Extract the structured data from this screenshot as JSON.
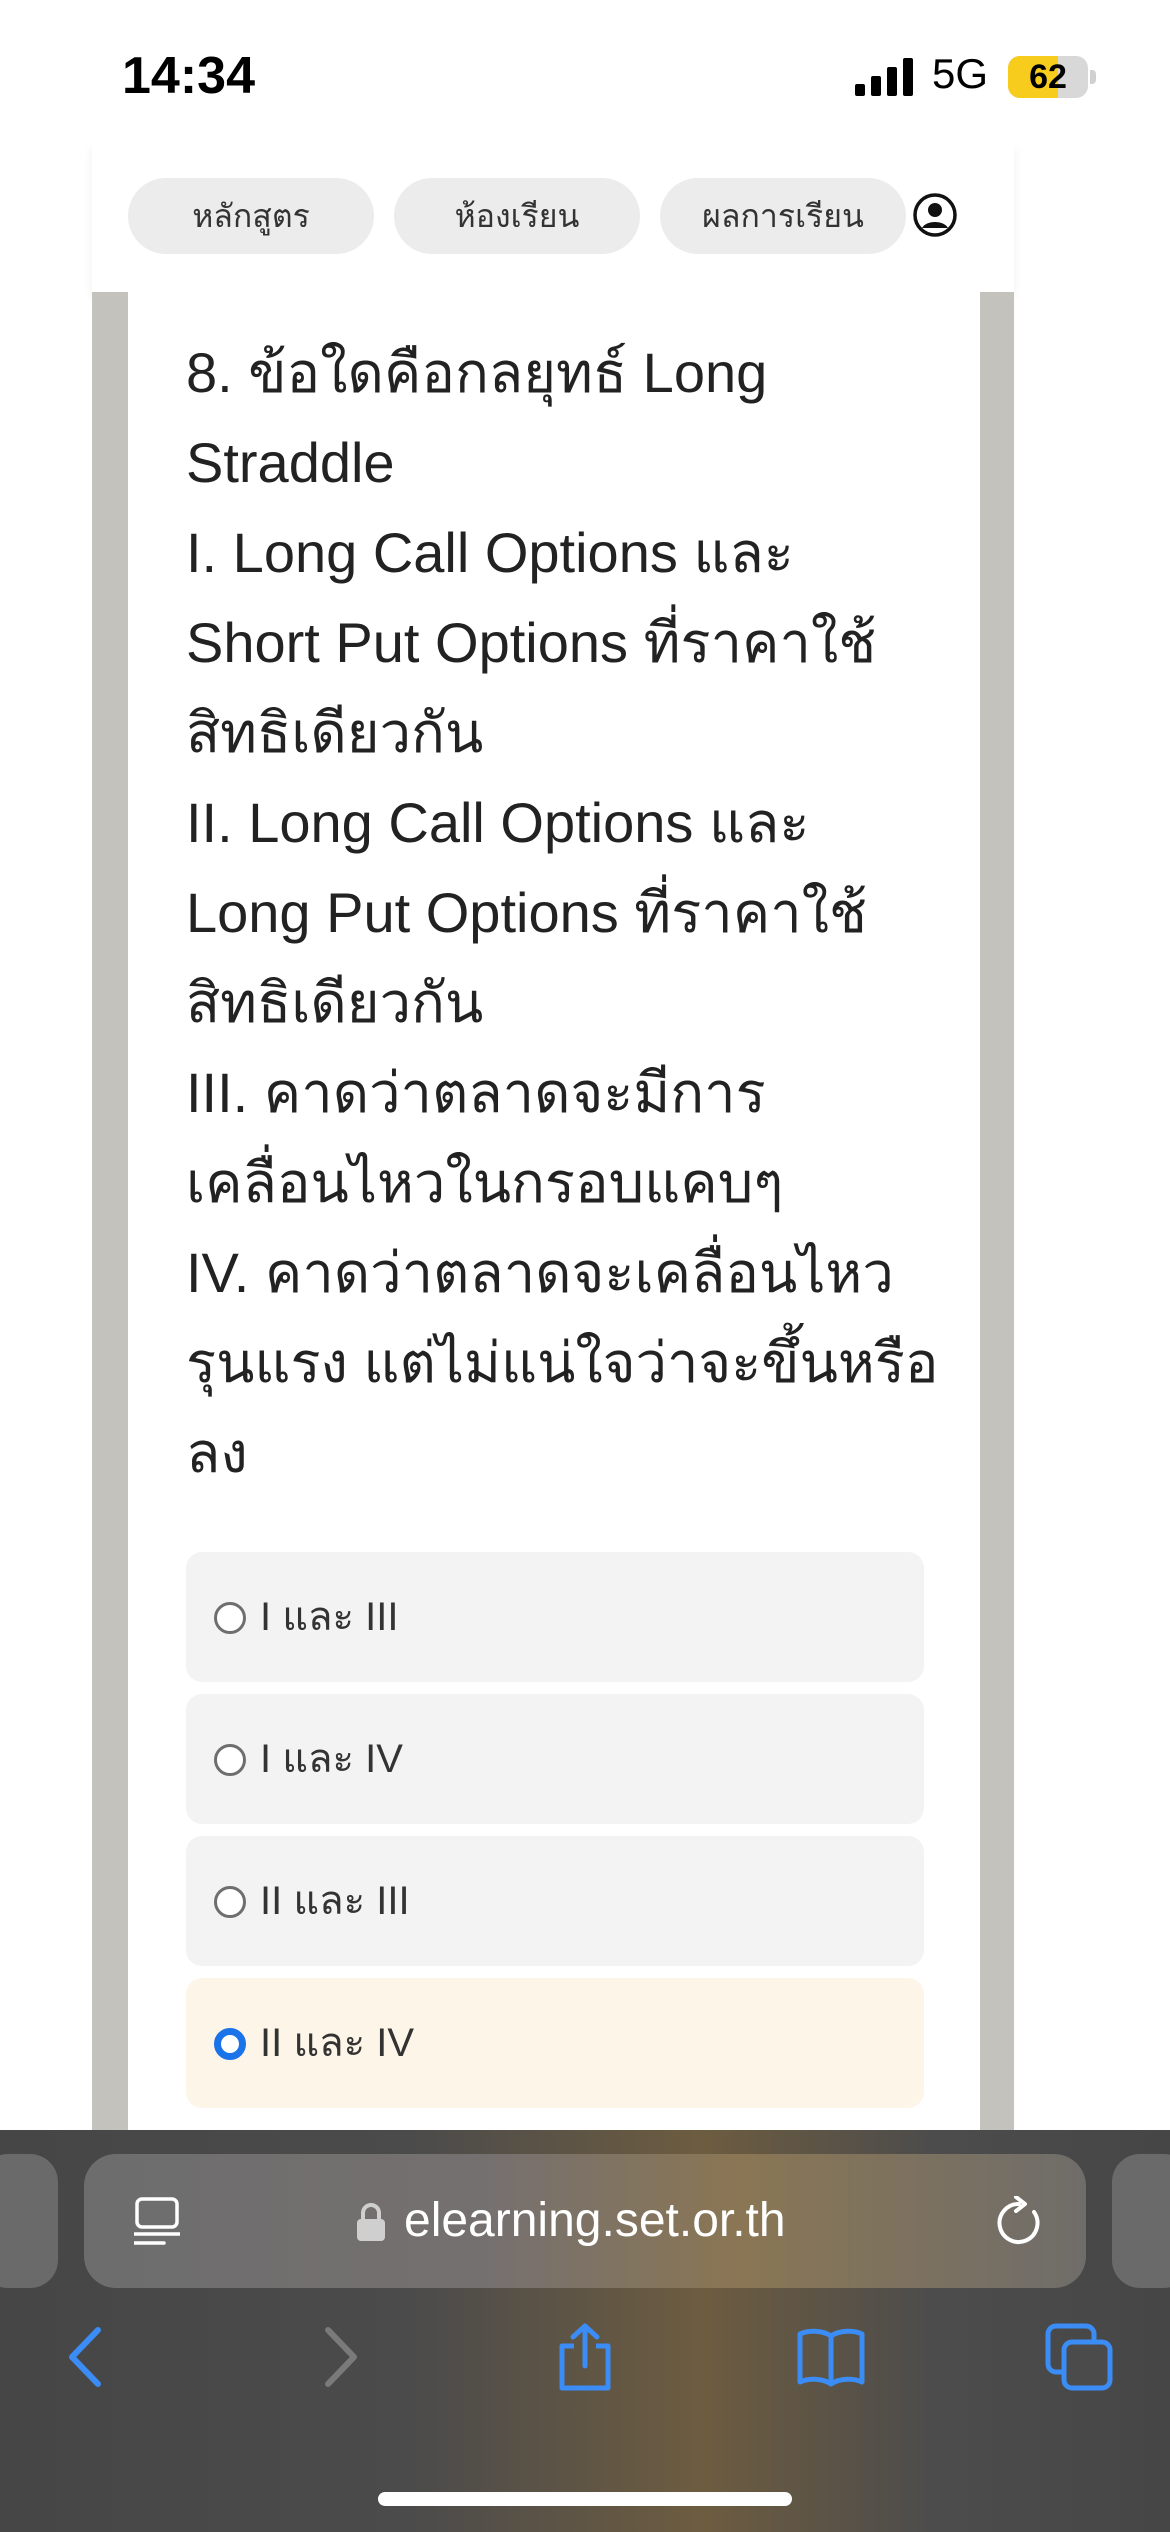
{
  "status_bar": {
    "time": "14:34",
    "network": "5G",
    "battery_level": "62",
    "battery_fraction": 0.62,
    "battery_color": "#f7cc1d"
  },
  "nav": {
    "tabs": [
      {
        "label": "หลักสูตร"
      },
      {
        "label": "ห้องเรียน"
      },
      {
        "label": "ผลการเรียน"
      }
    ]
  },
  "question": {
    "lines": [
      "8. ข้อใดคือกลยุทธ์ Long",
      "Straddle",
      "I. Long Call Options และ",
      "Short Put Options ที่ราคาใช้",
      "สิทธิเดียวกัน",
      "II. Long Call Options และ",
      "Long Put Options ที่ราคาใช้",
      "สิทธิเดียวกัน",
      "III. คาดว่าตลาดจะมีการ",
      "เคลื่อนไหวในกรอบแคบๆ",
      "IV. คาดว่าตลาดจะเคลื่อนไหว",
      "รุนแรง แต่ไม่แน่ใจว่าจะขึ้นหรือ",
      "ลง"
    ]
  },
  "options": [
    {
      "label": "I และ III",
      "selected": false
    },
    {
      "label": "I และ IV",
      "selected": false
    },
    {
      "label": "II และ III",
      "selected": false
    },
    {
      "label": "II และ IV",
      "selected": true
    }
  ],
  "browser": {
    "url": "elearning.set.or.th",
    "accent_color": "#3b8cf5"
  },
  "icons": {
    "status": [
      "cellular-signal-icon",
      "battery-icon"
    ],
    "nav": [
      "user-account-icon"
    ],
    "browser": [
      "reader-view-icon",
      "lock-icon",
      "reload-icon",
      "back-icon",
      "forward-icon",
      "share-icon",
      "bookmarks-icon",
      "tabs-icon"
    ]
  }
}
